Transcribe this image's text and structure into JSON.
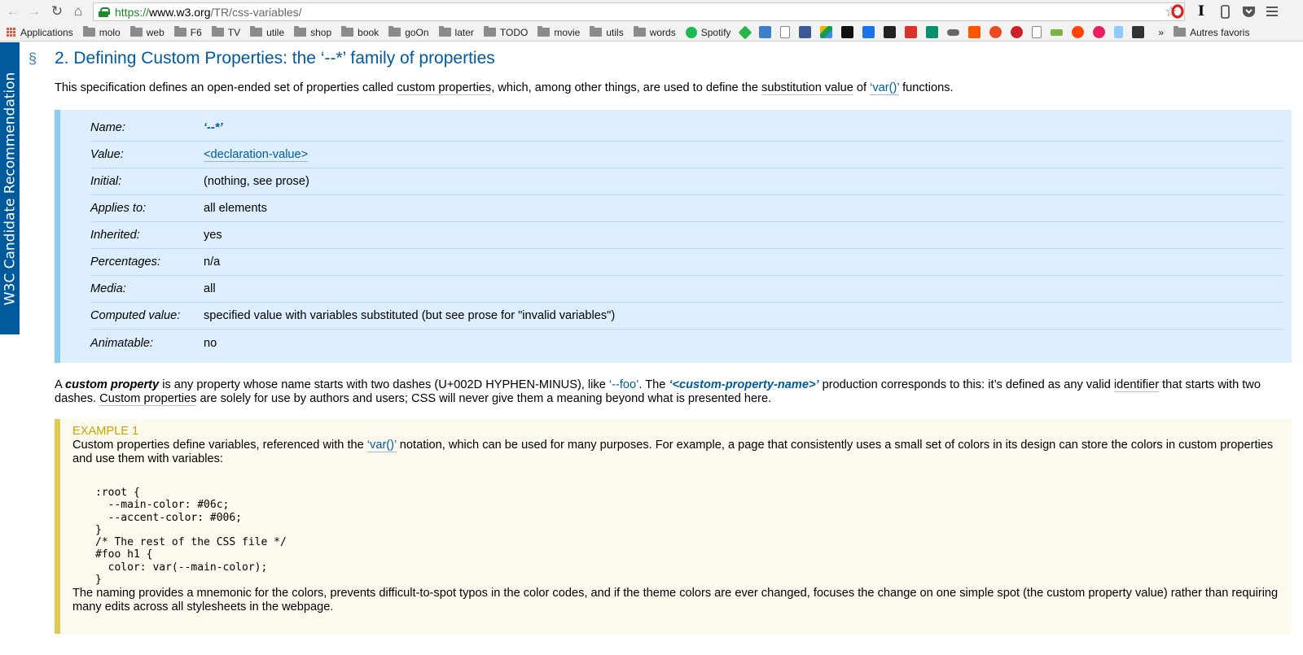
{
  "browser": {
    "url_scheme": "https://",
    "url_host": "www.w3.org",
    "url_path": "/TR/css-variables/",
    "bookmarks": [
      "Applications",
      "molo",
      "web",
      "F6",
      "TV",
      "utile",
      "shop",
      "book",
      "goOn",
      "later",
      "TODO",
      "movie",
      "utils",
      "words",
      "Spotify"
    ],
    "overflow": "»",
    "other_bookmarks": "Autres favoris"
  },
  "sidebar": {
    "status": "W3C Candidate Recommendation"
  },
  "section": {
    "marker": "§",
    "heading": "2. Defining Custom Properties: the ‘--*’ family of properties",
    "intro": {
      "t1": "This specification defines an open-ended set of properties called ",
      "l1": "custom properties",
      "t2": ", which, among other things, are used to define the ",
      "l2": "substitution value",
      "t3": " of ",
      "l3": "‘var()’",
      "t4": " functions."
    }
  },
  "propdef": [
    {
      "key": "Name:",
      "value": "‘--*’"
    },
    {
      "key": "Value:",
      "value": "<declaration-value>"
    },
    {
      "key": "Initial:",
      "value": "(nothing, see prose)"
    },
    {
      "key": "Applies to:",
      "value": "all elements"
    },
    {
      "key": "Inherited:",
      "value": "yes"
    },
    {
      "key": "Percentages:",
      "value": "n/a"
    },
    {
      "key": "Media:",
      "value": "all"
    },
    {
      "key": "Computed value:",
      "value": "specified value with variables substituted (but see prose for \"invalid variables\")"
    },
    {
      "key": "Animatable:",
      "value": "no"
    }
  ],
  "definition": {
    "t1": "A ",
    "term": "custom property",
    "t2": " is any property whose name starts with two dashes (U+002D HYPHEN-MINUS), like ",
    "foo": "‘--foo’",
    "t3": ". The ",
    "prod": "‘<custom-property-name>’",
    "t4": " production corresponds to this: it’s defined as any valid ",
    "ident": "identifier",
    "t5": " that starts with two dashes. ",
    "cp": "Custom properties",
    "t6": " are solely for use by authors and users; CSS will never give them a meaning beyond what is presented here."
  },
  "example": {
    "title": "EXAMPLE 1",
    "p1a": "Custom properties define variables, referenced with the ",
    "p1link": "‘var()’",
    "p1b": " notation, which can be used for many purposes. For example, a page that consistently uses a small set of colors in its design can store the colors in custom properties and use them with variables:",
    "code": ":root {\n  --main-color: #06c;\n  --accent-color: #006;\n}\n/* The rest of the CSS file */\n#foo h1 {\n  color: var(--main-color);\n}",
    "p2": "The naming provides a mnemonic for the colors, prevents difficult-to-spot typos in the color codes, and if the theme colors are ever changed, focuses the change on one simple spot (the custom property value) rather than requiring many edits across all stylesheets in the webpage."
  }
}
